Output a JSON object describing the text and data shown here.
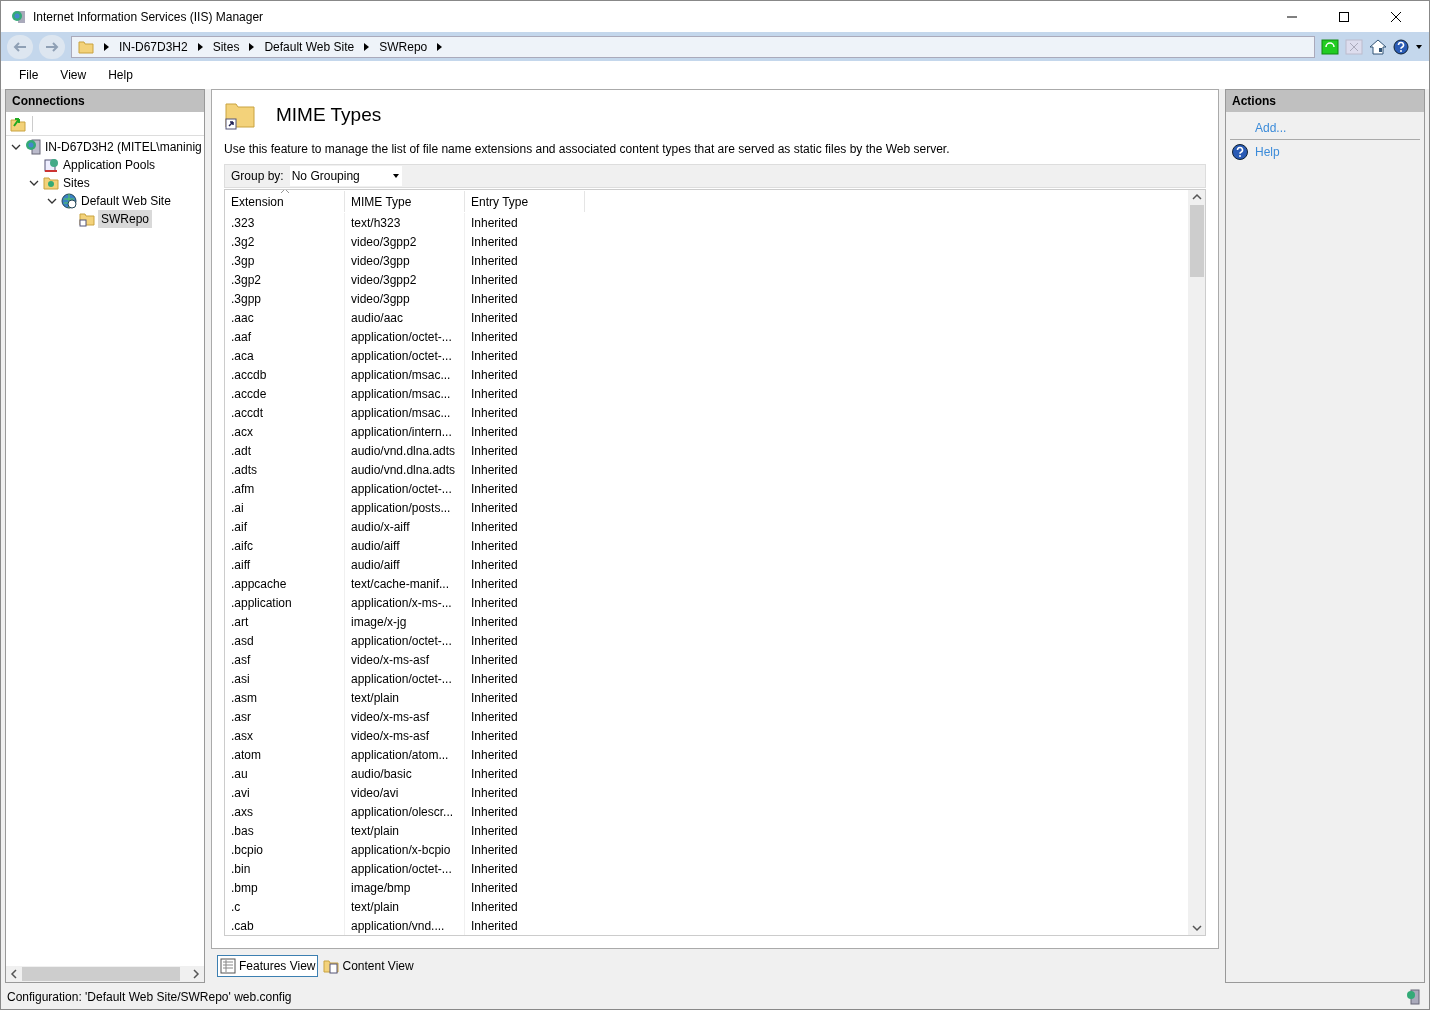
{
  "window": {
    "title": "Internet Information Services (IIS) Manager"
  },
  "address_bar": {
    "crumbs": [
      "IN-D67D3H2",
      "Sites",
      "Default Web Site",
      "SWRepo"
    ]
  },
  "menu": [
    "File",
    "View",
    "Help"
  ],
  "connections": {
    "title": "Connections",
    "tree": [
      {
        "label": "IN-D67D3H2 (MITEL\\maninig",
        "kind": "server",
        "expanded": true,
        "selected": false,
        "children": [
          {
            "label": "Application Pools",
            "kind": "pools",
            "selected": false
          },
          {
            "label": "Sites",
            "kind": "sites",
            "expanded": true,
            "selected": false,
            "children": [
              {
                "label": "Default Web Site",
                "kind": "site",
                "expanded": true,
                "selected": false,
                "children": [
                  {
                    "label": "SWRepo",
                    "kind": "folder",
                    "selected": true
                  }
                ]
              }
            ]
          }
        ]
      }
    ]
  },
  "feature": {
    "title": "MIME Types",
    "description": "Use this feature to manage the list of file name extensions and associated content types that are served as static files by the Web server.",
    "group_by": {
      "label": "Group by:",
      "value": "No Grouping"
    },
    "table": {
      "columns": [
        {
          "label": "Extension",
          "sorted": true
        },
        {
          "label": "MIME Type",
          "sorted": false
        },
        {
          "label": "Entry Type",
          "sorted": false
        }
      ],
      "rows": [
        [
          ".323",
          "text/h323",
          "Inherited"
        ],
        [
          ".3g2",
          "video/3gpp2",
          "Inherited"
        ],
        [
          ".3gp",
          "video/3gpp",
          "Inherited"
        ],
        [
          ".3gp2",
          "video/3gpp2",
          "Inherited"
        ],
        [
          ".3gpp",
          "video/3gpp",
          "Inherited"
        ],
        [
          ".aac",
          "audio/aac",
          "Inherited"
        ],
        [
          ".aaf",
          "application/octet-...",
          "Inherited"
        ],
        [
          ".aca",
          "application/octet-...",
          "Inherited"
        ],
        [
          ".accdb",
          "application/msac...",
          "Inherited"
        ],
        [
          ".accde",
          "application/msac...",
          "Inherited"
        ],
        [
          ".accdt",
          "application/msac...",
          "Inherited"
        ],
        [
          ".acx",
          "application/intern...",
          "Inherited"
        ],
        [
          ".adt",
          "audio/vnd.dlna.adts",
          "Inherited"
        ],
        [
          ".adts",
          "audio/vnd.dlna.adts",
          "Inherited"
        ],
        [
          ".afm",
          "application/octet-...",
          "Inherited"
        ],
        [
          ".ai",
          "application/posts...",
          "Inherited"
        ],
        [
          ".aif",
          "audio/x-aiff",
          "Inherited"
        ],
        [
          ".aifc",
          "audio/aiff",
          "Inherited"
        ],
        [
          ".aiff",
          "audio/aiff",
          "Inherited"
        ],
        [
          ".appcache",
          "text/cache-manif...",
          "Inherited"
        ],
        [
          ".application",
          "application/x-ms-...",
          "Inherited"
        ],
        [
          ".art",
          "image/x-jg",
          "Inherited"
        ],
        [
          ".asd",
          "application/octet-...",
          "Inherited"
        ],
        [
          ".asf",
          "video/x-ms-asf",
          "Inherited"
        ],
        [
          ".asi",
          "application/octet-...",
          "Inherited"
        ],
        [
          ".asm",
          "text/plain",
          "Inherited"
        ],
        [
          ".asr",
          "video/x-ms-asf",
          "Inherited"
        ],
        [
          ".asx",
          "video/x-ms-asf",
          "Inherited"
        ],
        [
          ".atom",
          "application/atom...",
          "Inherited"
        ],
        [
          ".au",
          "audio/basic",
          "Inherited"
        ],
        [
          ".avi",
          "video/avi",
          "Inherited"
        ],
        [
          ".axs",
          "application/olescr...",
          "Inherited"
        ],
        [
          ".bas",
          "text/plain",
          "Inherited"
        ],
        [
          ".bcpio",
          "application/x-bcpio",
          "Inherited"
        ],
        [
          ".bin",
          "application/octet-...",
          "Inherited"
        ],
        [
          ".bmp",
          "image/bmp",
          "Inherited"
        ],
        [
          ".c",
          "text/plain",
          "Inherited"
        ],
        [
          ".cab",
          "application/vnd....",
          "Inherited"
        ]
      ]
    }
  },
  "view_tabs": [
    {
      "label": "Features View",
      "kind": "features",
      "selected": true
    },
    {
      "label": "Content View",
      "kind": "content",
      "selected": false
    }
  ],
  "actions": {
    "title": "Actions",
    "items": [
      {
        "label": "Add...",
        "kind": "link"
      },
      {
        "label": "Help",
        "kind": "help"
      }
    ]
  },
  "status_bar": {
    "text": "Configuration: 'Default Web Site/SWRepo' web.config"
  }
}
